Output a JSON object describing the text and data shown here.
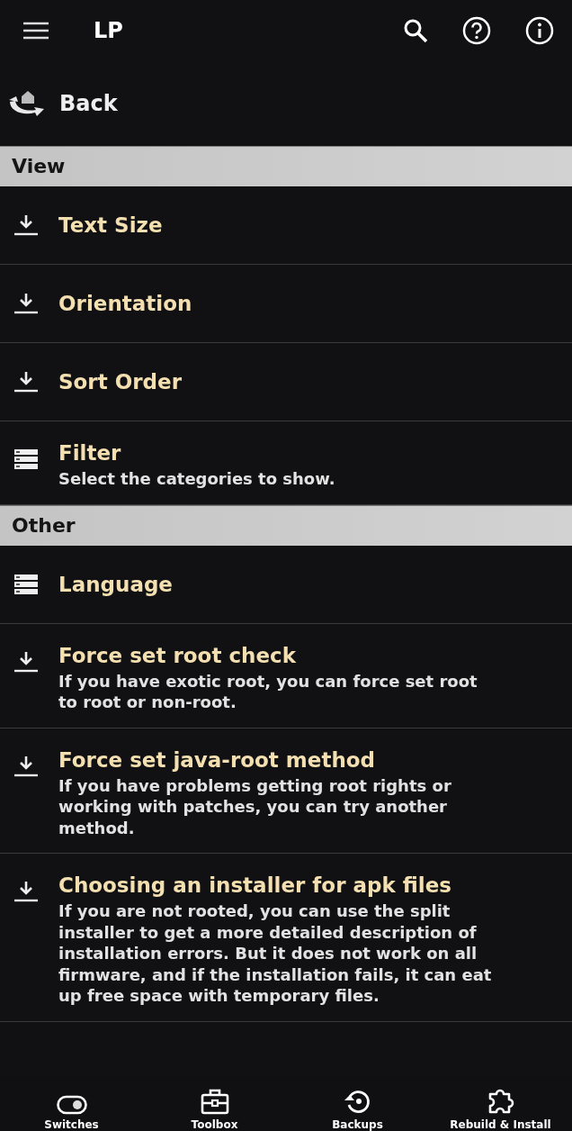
{
  "app_bar": {
    "title": "LP"
  },
  "back": {
    "label": "Back"
  },
  "sections": [
    {
      "title": "View",
      "items": [
        {
          "kind": "download",
          "title": "Text Size"
        },
        {
          "kind": "download",
          "title": "Orientation"
        },
        {
          "kind": "download",
          "title": "Sort Order"
        },
        {
          "kind": "list",
          "title": "Filter",
          "description": "Select the categories to show."
        }
      ]
    },
    {
      "title": "Other",
      "items": [
        {
          "kind": "list",
          "title": "Language"
        },
        {
          "kind": "download",
          "title": "Force set root check",
          "description": "If you have exotic root, you can force set root to root or non-root."
        },
        {
          "kind": "download",
          "title": "Force set java-root method",
          "description": "If you have problems getting root rights or working with patches, you can try another method."
        },
        {
          "kind": "download",
          "title": "Choosing an installer for apk files",
          "description": "If you are not rooted, you can use the split installer to get a more detailed description of installation errors. But it does not work on all firmware, and if the installation fails, it can eat up free space with temporary files."
        }
      ]
    }
  ],
  "bottom_nav": [
    {
      "label": "Switches"
    },
    {
      "label": "Toolbox"
    },
    {
      "label": "Backups"
    },
    {
      "label": "Rebuild & Install"
    }
  ]
}
